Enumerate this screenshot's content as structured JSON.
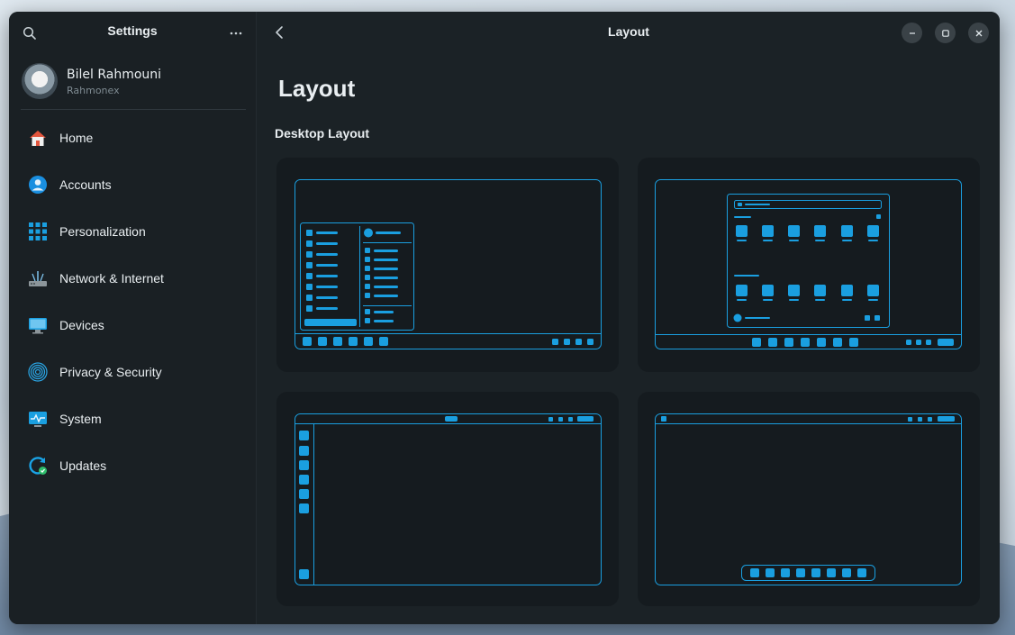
{
  "sidebar": {
    "title": "Settings",
    "profile": {
      "name": "Bilel Rahmouni",
      "username": "Rahmonex"
    },
    "items": [
      {
        "label": "Home",
        "icon": "home-icon"
      },
      {
        "label": "Accounts",
        "icon": "account-icon"
      },
      {
        "label": "Personalization",
        "icon": "grid-icon"
      },
      {
        "label": "Network & Internet",
        "icon": "network-icon"
      },
      {
        "label": "Devices",
        "icon": "monitor-icon"
      },
      {
        "label": "Privacy & Security",
        "icon": "fingerprint-icon"
      },
      {
        "label": "System",
        "icon": "system-icon"
      },
      {
        "label": "Updates",
        "icon": "update-icon"
      }
    ]
  },
  "header": {
    "title": "Layout"
  },
  "main": {
    "heading": "Layout",
    "section_title": "Desktop Layout",
    "layouts": [
      {
        "id": "classic-start-menu"
      },
      {
        "id": "centered-launcher"
      },
      {
        "id": "top-bar-left-dock"
      },
      {
        "id": "top-bar-bottom-dock"
      }
    ]
  },
  "colors": {
    "accent": "#1a9fe0",
    "window_bg": "#1b2226",
    "sidebar_bg": "#1a2024",
    "card_bg": "#151b1f"
  }
}
